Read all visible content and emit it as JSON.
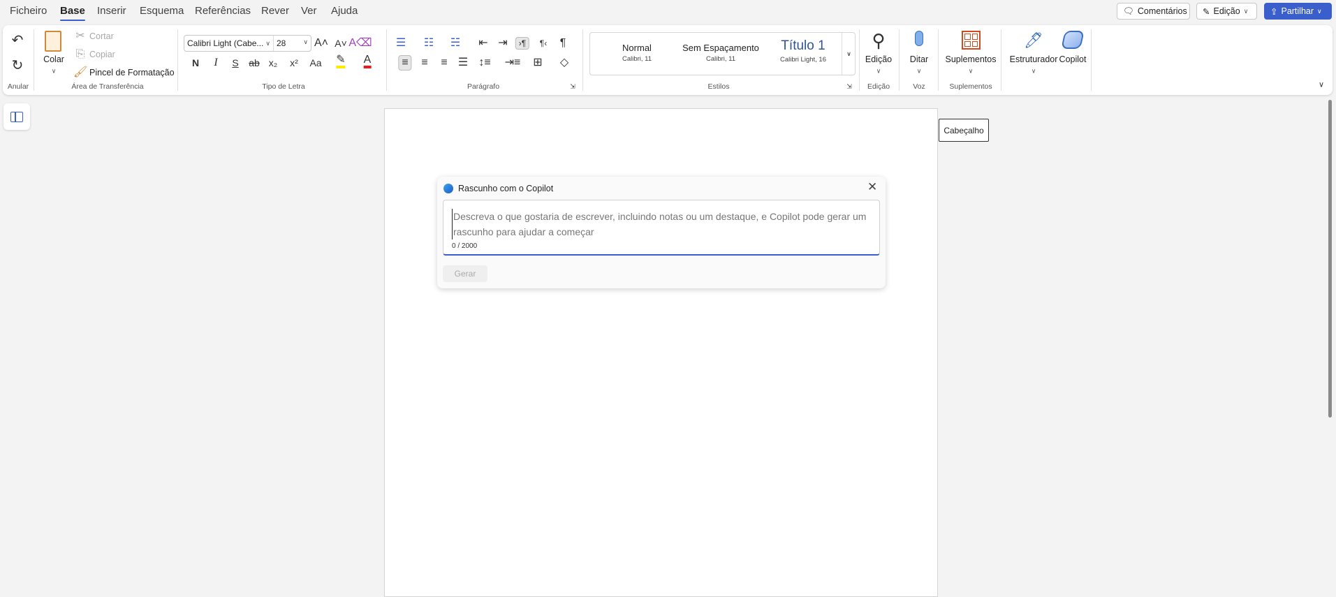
{
  "tabs": [
    "Ficheiro",
    "Base",
    "Inserir",
    "Esquema",
    "Referências",
    "Rever",
    "Ver",
    "Ajuda"
  ],
  "active_tab": "Base",
  "top_buttons": {
    "comments": "Comentários",
    "editing": "Edição",
    "share": "Partilhar"
  },
  "accent": "#3a5fcd",
  "ribbon": {
    "undo_group": "Anular",
    "clipboard": {
      "paste": "Colar",
      "cut": "Cortar",
      "copy": "Copiar",
      "format_painter": "Pincel de Formatação",
      "label": "Área de Transferência"
    },
    "font": {
      "name": "Calibri Light (Cabe...",
      "size": "28",
      "bold": "N",
      "italic": "I",
      "underline": "S",
      "strike": "ab",
      "case": "Aa",
      "label": "Tipo de Letra"
    },
    "paragraph": {
      "label": "Parágrafo"
    },
    "styles": {
      "items": [
        {
          "name": "Normal",
          "sub": "Calibri, 11"
        },
        {
          "name": "Sem Espaçamento",
          "sub": "Calibri, 11"
        },
        {
          "name": "Título 1",
          "sub": "Calibri Light, 16"
        }
      ],
      "label": "Estilos"
    },
    "editing": {
      "button": "Edição",
      "label": "Edição"
    },
    "voice": {
      "button": "Ditar",
      "label": "Voz"
    },
    "addins": {
      "button": "Suplementos",
      "label": "Suplementos"
    },
    "designer": "Estruturador",
    "copilot": "Copilot"
  },
  "tooltip": "Cabeçalho",
  "dialog": {
    "title": "Rascunho com o Copilot",
    "placeholder": "Descreva o que gostaria de escrever, incluindo notas ou um destaque, e Copilot pode gerar um rascunho para ajudar a começar",
    "counter": "0 / 2000",
    "generate": "Gerar"
  }
}
